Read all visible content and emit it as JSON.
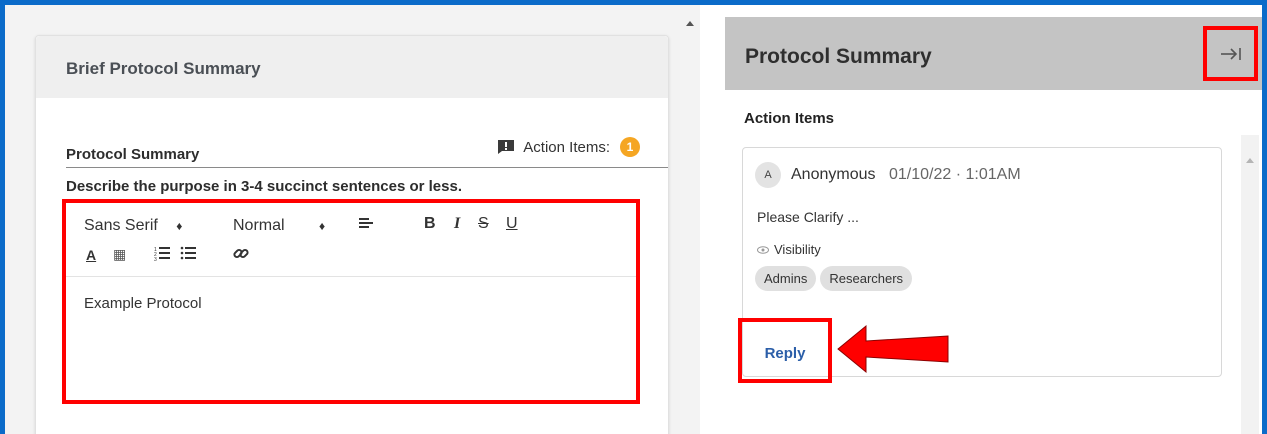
{
  "left_card": {
    "title": "Brief Protocol Summary",
    "field_label": "Protocol Summary",
    "action_items_label": "Action Items:",
    "action_items_count": "1",
    "help_text": "Describe the purpose in 3-4 succinct sentences or less.",
    "editor": {
      "font_select": "Sans Serif",
      "size_select": "Normal",
      "content": "Example Protocol",
      "toolbar_icons": [
        "align-icon",
        "bold-icon",
        "italic-icon",
        "strikethrough-icon",
        "underline-icon",
        "text-color-icon",
        "background-color-icon",
        "ordered-list-icon",
        "bullet-list-icon",
        "link-icon"
      ]
    }
  },
  "right_panel": {
    "title": "Protocol Summary",
    "section_label": "Action Items",
    "comment": {
      "avatar_initial": "A",
      "author": "Anonymous",
      "timestamp": "01/10/22 · 1:01AM",
      "text": "Please Clarify ...",
      "visibility_label": "Visibility",
      "tags": [
        "Admins",
        "Researchers"
      ],
      "reply_label": "Reply"
    }
  },
  "colors": {
    "frame_border": "#0b6bc9",
    "highlight": "#ff0000",
    "badge": "#f5a623",
    "reply_link": "#2b5ea8",
    "panel_header": "#c4c4c4"
  }
}
